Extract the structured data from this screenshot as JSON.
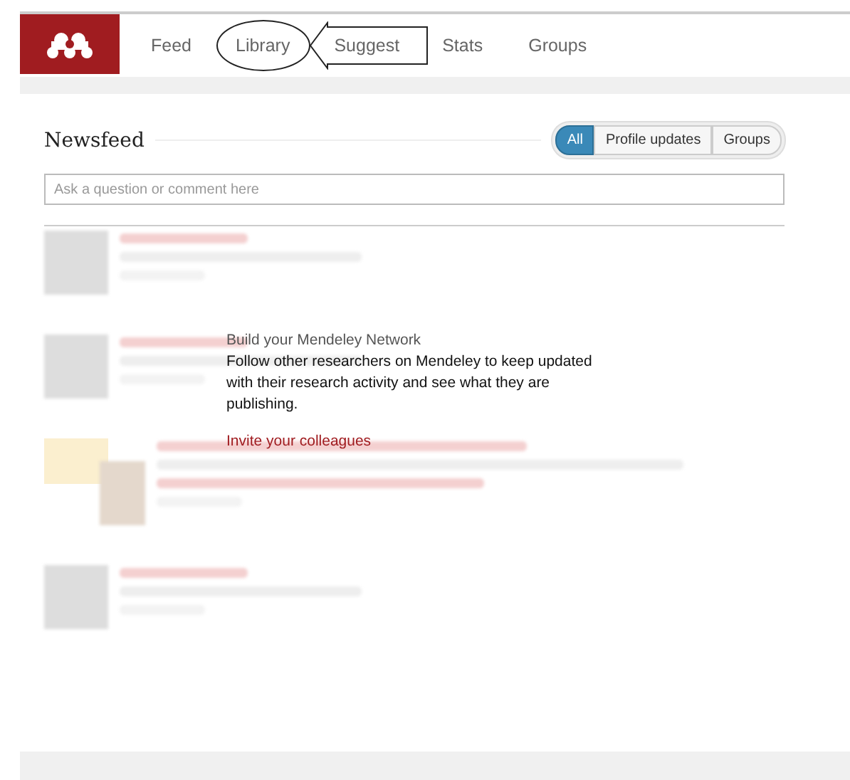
{
  "nav": {
    "items": [
      {
        "label": "Feed",
        "circled": false
      },
      {
        "label": "Library",
        "circled": true
      },
      {
        "label": "Suggest",
        "circled": false
      },
      {
        "label": "Stats",
        "circled": false
      },
      {
        "label": "Groups",
        "circled": false
      }
    ]
  },
  "newsfeed": {
    "title": "Newsfeed",
    "filters": [
      {
        "label": "All",
        "selected": true
      },
      {
        "label": "Profile updates",
        "selected": false
      },
      {
        "label": "Groups",
        "selected": false
      }
    ],
    "input": {
      "placeholder": "Ask a question or comment here"
    },
    "blurred_items": [
      {
        "kind": "person"
      },
      {
        "kind": "person"
      },
      {
        "kind": "publication"
      },
      {
        "kind": "person"
      }
    ],
    "prompt": {
      "title": "Build your Mendeley Network",
      "body": "Follow other researchers on Mendeley to keep updated with their research activity and see what they are publishing.",
      "link": "Invite your colleagues"
    }
  }
}
